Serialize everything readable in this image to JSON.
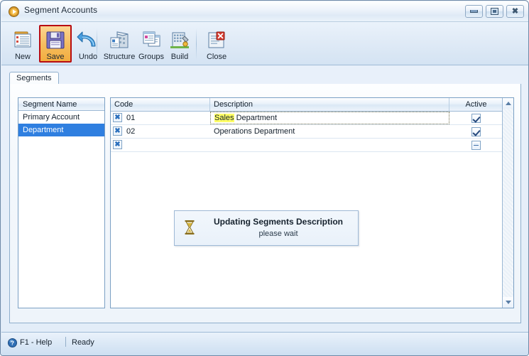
{
  "window": {
    "title": "Segment Accounts",
    "title_icon": "play-circle-icon",
    "controls": {
      "minimize": "minimize-icon",
      "maximize": "maximize-icon",
      "close": "close-icon"
    }
  },
  "toolbar": {
    "items": [
      {
        "label": "New",
        "icon": "new-document-icon",
        "highlighted": false
      },
      {
        "label": "Save",
        "icon": "floppy-disk-icon",
        "highlighted": true
      },
      {
        "label": "Undo",
        "icon": "undo-arrow-icon",
        "highlighted": false
      },
      {
        "label": "Structure",
        "icon": "structure-icon",
        "highlighted": false
      },
      {
        "label": "Groups",
        "icon": "groups-windows-icon",
        "highlighted": false
      },
      {
        "label": "Build",
        "icon": "build-tools-icon",
        "highlighted": false
      },
      {
        "label": "Close",
        "icon": "close-document-icon",
        "highlighted": false
      }
    ]
  },
  "tabs": [
    {
      "label": "Segments",
      "active": true
    }
  ],
  "segment_list": {
    "header": "Segment Name",
    "items": [
      {
        "label": "Primary Account",
        "selected": false
      },
      {
        "label": "Department",
        "selected": true
      }
    ]
  },
  "grid": {
    "columns": [
      {
        "label": "Code"
      },
      {
        "label": "Description"
      },
      {
        "label": "Active"
      }
    ],
    "rows": [
      {
        "delete_icon": "delete-x-icon",
        "code": "01",
        "description_prefix": "Sales",
        "description_rest": " Department",
        "description_highlighted": true,
        "editing": true,
        "active": "checked"
      },
      {
        "delete_icon": "delete-x-icon",
        "code": "02",
        "description_prefix": "",
        "description_rest": "Operations Department",
        "description_highlighted": false,
        "editing": false,
        "active": "checked"
      },
      {
        "delete_icon": "delete-x-icon",
        "code": "",
        "description_prefix": "",
        "description_rest": "",
        "description_highlighted": false,
        "editing": false,
        "active": "partial"
      }
    ],
    "scrollbar": {
      "up_icon": "scroll-up-arrow-icon",
      "down_icon": "scroll-down-arrow-icon"
    }
  },
  "wait_dialog": {
    "icon": "hourglass-icon",
    "title": "Updating Segments Description",
    "subtitle": "please wait"
  },
  "statusbar": {
    "help_icon": "help-question-icon",
    "help_label": "F1 - Help",
    "status": "Ready"
  },
  "colors": {
    "accent_selection": "#2f7fe0",
    "highlight_annotation": "#b80d12",
    "toolbar_hover": "#f6bc5c",
    "text_highlight": "#ffff66"
  }
}
